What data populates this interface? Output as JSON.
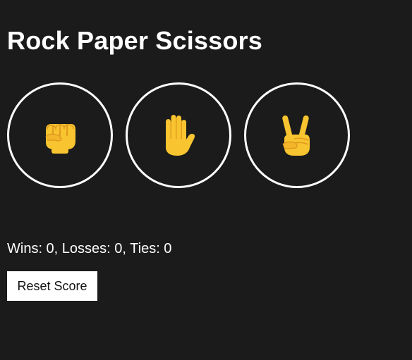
{
  "game": {
    "title": "Rock Paper Scissors",
    "choices": [
      {
        "name": "rock",
        "icon": "raised-fist-icon"
      },
      {
        "name": "paper",
        "icon": "raised-hand-icon"
      },
      {
        "name": "scissors",
        "icon": "victory-hand-icon"
      }
    ],
    "score_text": "Wins: 0, Losses: 0, Ties: 0",
    "reset_label": "Reset Score"
  },
  "colors": {
    "background": "#1b1b1b",
    "text": "#ffffff",
    "circle_border": "#ffffff",
    "button_bg": "#ffffff",
    "emoji_fill": "#f8c42f",
    "emoji_shade": "#e09b1f"
  }
}
